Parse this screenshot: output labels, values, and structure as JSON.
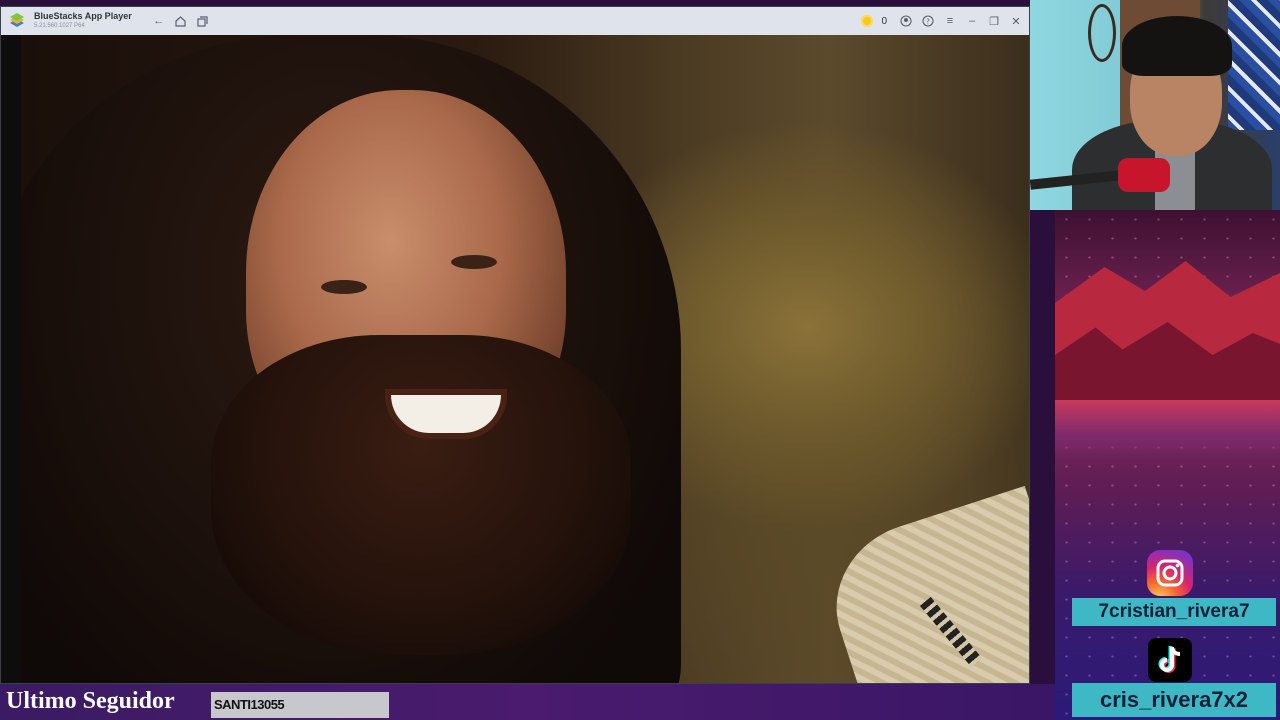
{
  "window": {
    "app_title": "BlueStacks App Player",
    "version": "5.21.560.1027 P64",
    "coin_count": "0"
  },
  "social": {
    "instagram_handle": "7cristian_rivera7",
    "tiktok_handle": "cris_rivera7x2"
  },
  "footer": {
    "follower_label": "Ultimo Seguidor",
    "follower_name": "SANTI13055"
  },
  "colors": {
    "titlebar": "#dfe4ec",
    "label_bg": "#3fb8c6",
    "bottom_bar": "#3b1b63"
  }
}
